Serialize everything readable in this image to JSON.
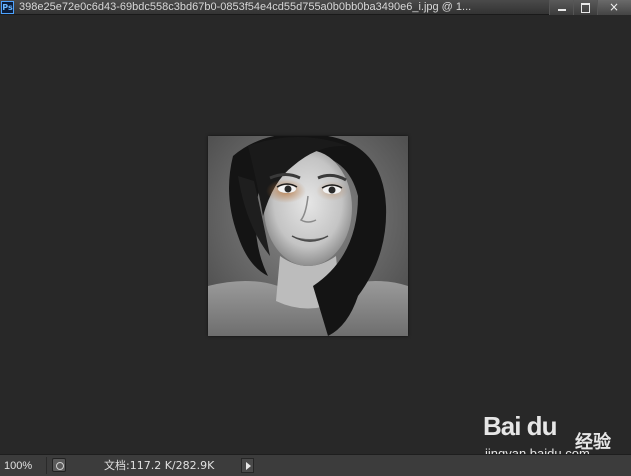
{
  "app": {
    "icon_label": "Ps",
    "title": "398e25e72e0c6d43-69bdc558c3bd67b0-0853f54e4cd55d755a0b0bb0ba3490e6_i.jpg @ 1..."
  },
  "window_controls": {
    "minimize": "minimize",
    "maximize": "maximize",
    "close": "×"
  },
  "status": {
    "zoom": "100%",
    "doc_info": "文档:117.2 K/282.9K"
  },
  "watermark": {
    "brand": "Bai du",
    "sub": "经验",
    "url": "jingyan.baidu.com"
  },
  "colors": {
    "canvas_bg": "#282828",
    "statusbar_bg": "#3c3c3c",
    "ps_accent": "#4da3ff"
  }
}
